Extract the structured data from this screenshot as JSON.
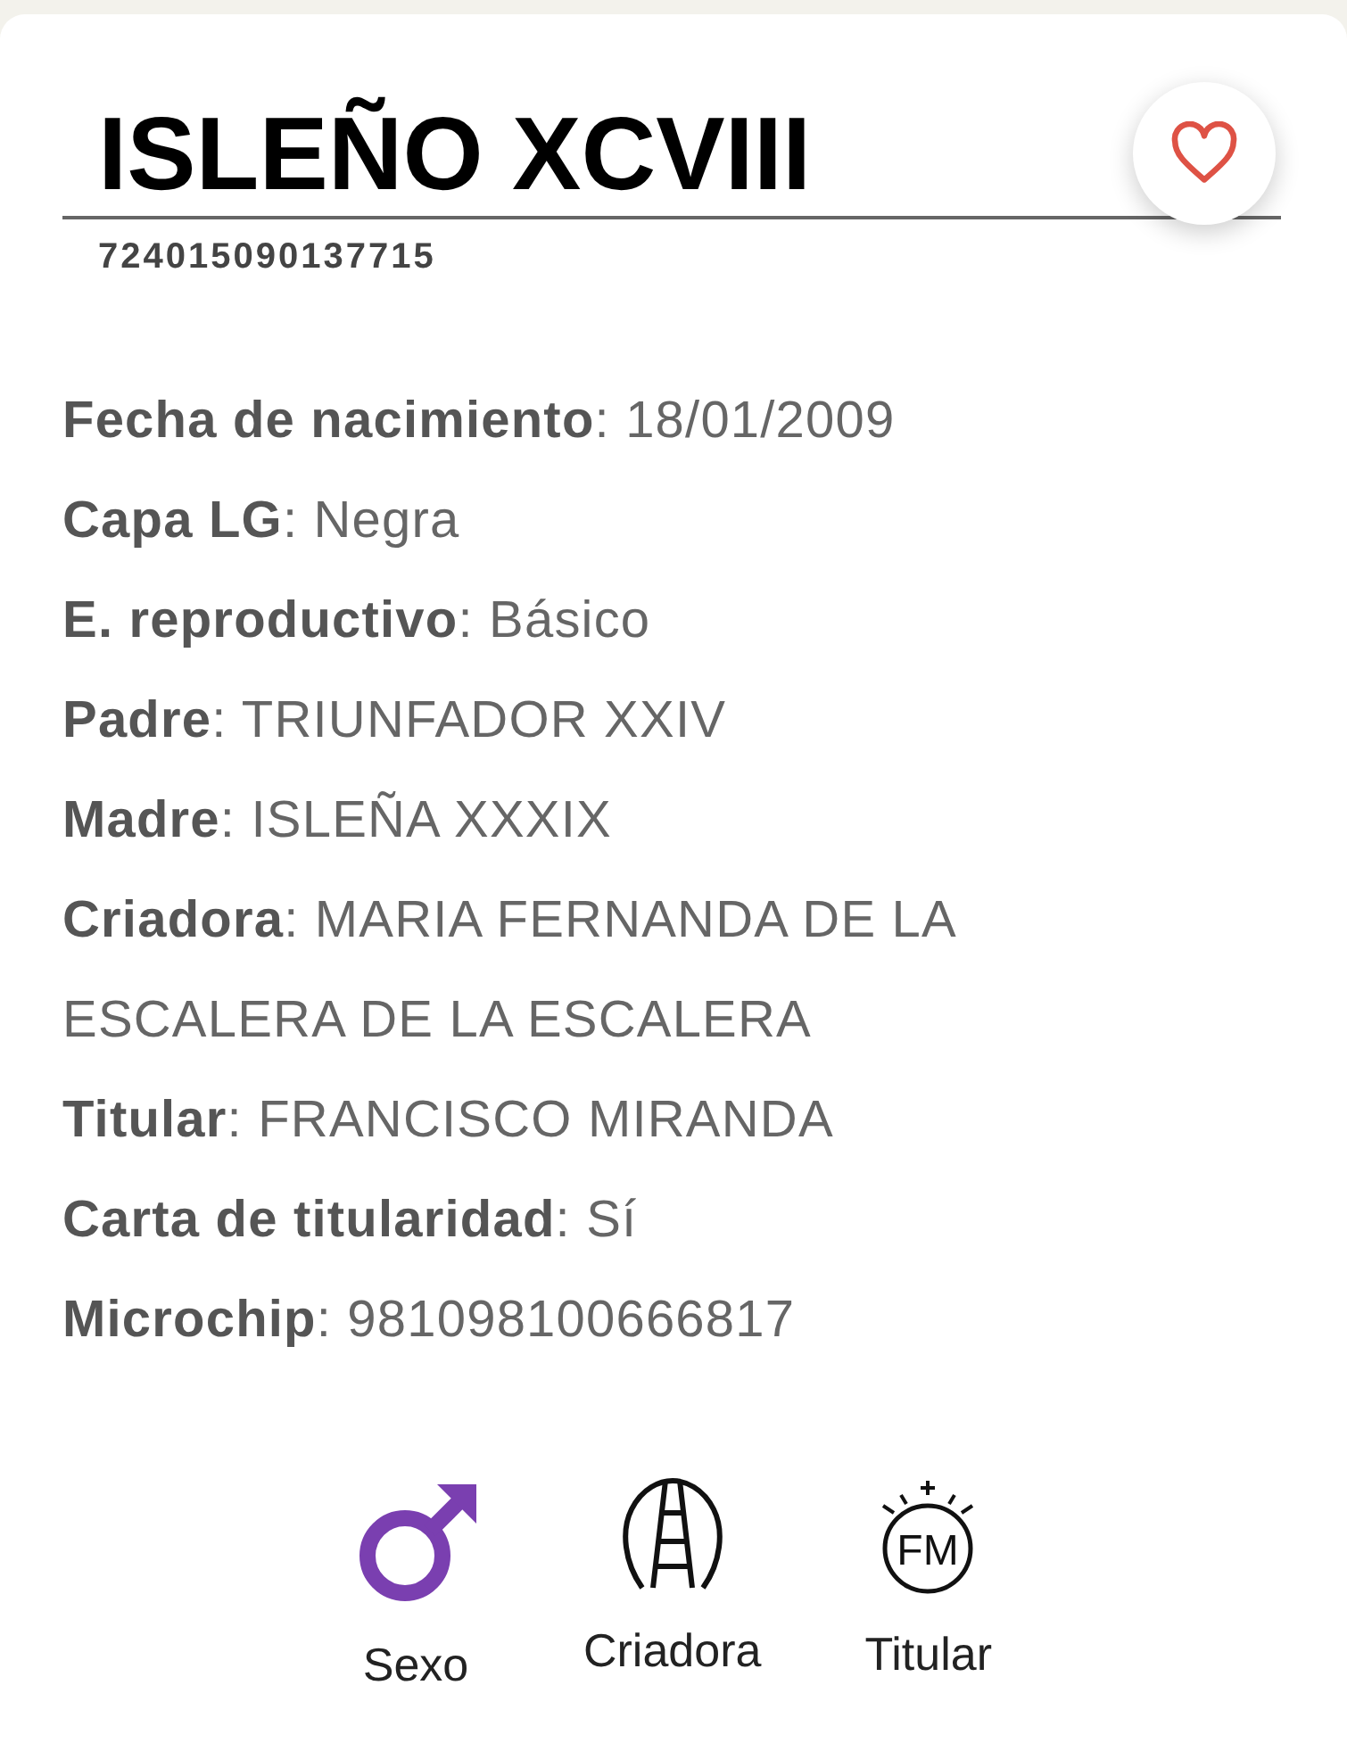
{
  "title": "ISLEÑO XCVIII",
  "code": "724015090137715",
  "favorite": false,
  "fields": [
    {
      "text": "**Fecha de nacimiento**: 18/01/2009"
    },
    {
      "text": "**Capa LG**: Negra"
    },
    {
      "text": "**E. reproductivo**: Básico"
    },
    {
      "text": "**Padre**: TRIUNFADOR XXIV"
    },
    {
      "text": "**Madre**: ISLEÑA XXXIX"
    },
    {
      "text": "**Criadora**: MARIA FERNANDA DE LA ESCALERA DE LA ESCALERA"
    },
    {
      "text": "**Titular**: FRANCISCO MIRANDA"
    },
    {
      "text": "**Carta de titularidad**: Sí"
    },
    {
      "text": "**Microchip**: 981098100666817"
    }
  ],
  "badges": [
    {
      "kind": "sex",
      "label": "Sexo"
    },
    {
      "kind": "breeder",
      "label": "Criadora"
    },
    {
      "kind": "owner",
      "label": "Titular",
      "mark": "FM"
    }
  ]
}
